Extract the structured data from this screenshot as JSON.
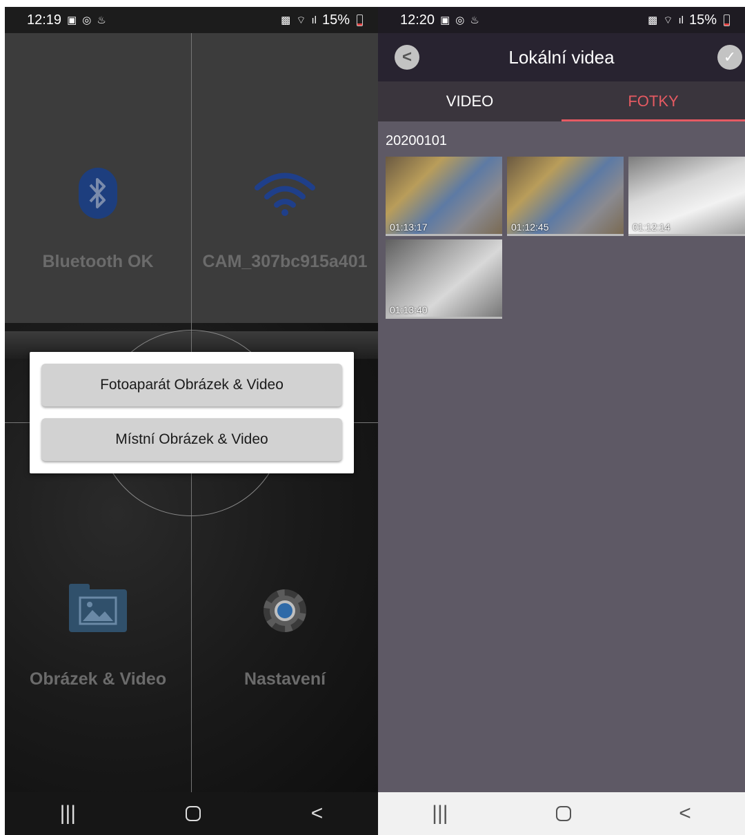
{
  "left_screen": {
    "statusbar": {
      "time": "12:19",
      "battery": "15%"
    },
    "bluetooth_label": "Bluetooth OK",
    "wifi_label": "CAM_307bc915a401",
    "gallery_label": "Obrázek & Video",
    "settings_label": "Nastavení",
    "dialog": {
      "option_camera": "Fotoaparát Obrázek & Video",
      "option_local": "Místní Obrázek & Video"
    }
  },
  "right_screen": {
    "statusbar": {
      "time": "12:20",
      "battery": "15%"
    },
    "title": "Lokální videa",
    "tabs": [
      "VIDEO",
      "FOTKY"
    ],
    "active_tab": "FOTKY",
    "date_group": "20200101",
    "thumbnails": [
      "01:13:17",
      "01:12:45",
      "01:12:14",
      "01:13:40"
    ]
  },
  "colors": {
    "accent": "#e65a62",
    "appbar": "#282330",
    "content_bg": "#5e5965",
    "dialog_button": "#d2d2d2"
  },
  "icons": {
    "status_left": [
      "gallery-icon",
      "sync-icon",
      "flame-icon"
    ],
    "status_right": [
      "sim-icon",
      "wifi-icon",
      "signal-icon",
      "battery-icon"
    ],
    "nav": [
      "recent-apps-icon",
      "home-icon",
      "back-icon"
    ]
  }
}
